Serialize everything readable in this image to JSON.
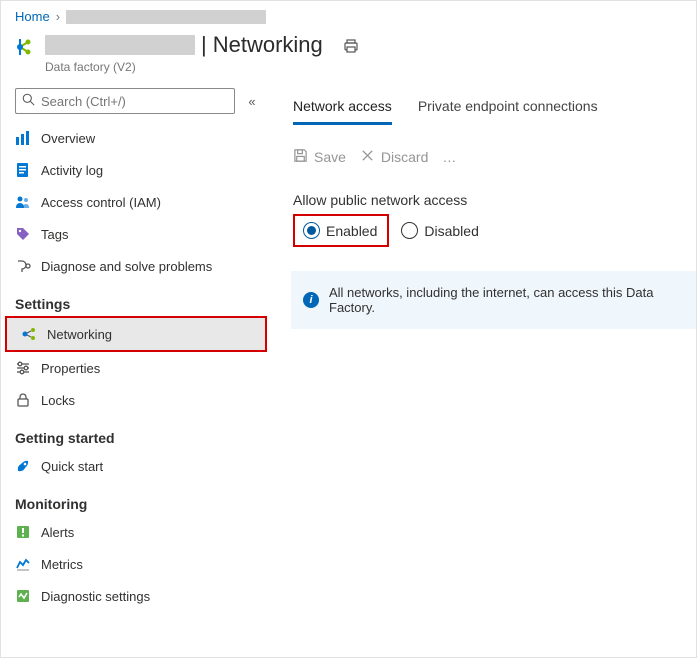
{
  "breadcrumb": {
    "home": "Home"
  },
  "header": {
    "title": "Networking",
    "subtitle": "Data factory (V2)",
    "pipe": "|"
  },
  "sidebar": {
    "search_placeholder": "Search (Ctrl+/)",
    "items": {
      "overview": "Overview",
      "activity": "Activity log",
      "iam": "Access control (IAM)",
      "tags": "Tags",
      "diagnose": "Diagnose and solve problems"
    },
    "sections": {
      "settings": "Settings",
      "getting_started": "Getting started",
      "monitoring": "Monitoring"
    },
    "settings_items": {
      "networking": "Networking",
      "properties": "Properties",
      "locks": "Locks"
    },
    "getting_items": {
      "quickstart": "Quick start"
    },
    "monitoring_items": {
      "alerts": "Alerts",
      "metrics": "Metrics",
      "diag": "Diagnostic settings"
    }
  },
  "main": {
    "tabs": {
      "network_access": "Network access",
      "private_endpoint": "Private endpoint connections"
    },
    "cmdbar": {
      "save": "Save",
      "discard": "Discard"
    },
    "section_label": "Allow public network access",
    "radio": {
      "enabled": "Enabled",
      "disabled": "Disabled"
    },
    "info": "All networks, including the internet, can access this Data Factory."
  }
}
